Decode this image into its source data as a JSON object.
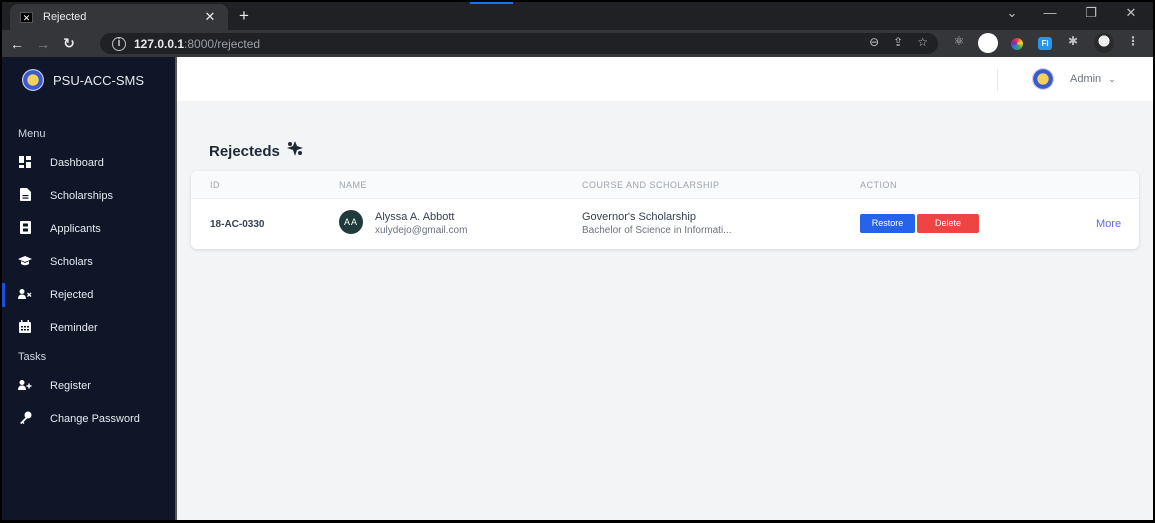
{
  "browser": {
    "tab_title": "Rejected",
    "tab_favicon": "x-icon",
    "url_host": "127.0.0.1",
    "url_path": ":8000/rejected",
    "toolbar_icons": [
      "zoom-out-icon",
      "share-icon",
      "bookmark-star-icon"
    ],
    "extensions": [
      "react-devtools-icon",
      "white-circle-extension-icon",
      "color-picker-extension-icon",
      "fi-extension-icon",
      "puzzle-extensions-icon",
      "profile-avatar-icon",
      "kebab-menu-icon"
    ]
  },
  "sidebar": {
    "brand": "PSU-ACC-SMS",
    "sections": [
      {
        "title": "Menu",
        "items": [
          {
            "label": "Dashboard",
            "icon": "dashboard-grid-icon",
            "glyph": "▚"
          },
          {
            "label": "Scholarships",
            "icon": "document-icon",
            "glyph": "▤"
          },
          {
            "label": "Applicants",
            "icon": "id-badge-icon",
            "glyph": "▣"
          },
          {
            "label": "Scholars",
            "icon": "graduation-cap-icon",
            "glyph": "🎓"
          },
          {
            "label": "Rejected",
            "icon": "user-x-icon",
            "glyph": "👤",
            "active": true
          },
          {
            "label": "Reminder",
            "icon": "calendar-icon",
            "glyph": "▦"
          }
        ]
      },
      {
        "title": "Tasks",
        "items": [
          {
            "label": "Register",
            "icon": "user-plus-icon",
            "glyph": "👤"
          },
          {
            "label": "Change Password",
            "icon": "key-icon",
            "glyph": "🔑"
          }
        ]
      }
    ]
  },
  "header": {
    "user": "Admin",
    "user_chevron": "⌄"
  },
  "page": {
    "title": "Rejecteds",
    "title_icon": "✦"
  },
  "table": {
    "columns": [
      "ID",
      "NAME",
      "COURSE AND SCHOLARSHIP",
      "ACTION"
    ],
    "rows": [
      {
        "id": "18-AC-0330",
        "initials": "AA",
        "name": "Alyssa A. Abbott",
        "email": "xulydejo@gmail.com",
        "scholarship": "Governor's Scholarship",
        "course": "Bachelor of Science in Informati...",
        "restore_label": "Restore",
        "delete_label": "Delete",
        "more_label": "More"
      }
    ]
  },
  "colors": {
    "sidebar_bg": "#0e1628",
    "accent": "#1d4ed8",
    "restore": "#2563eb",
    "delete": "#ef4444",
    "more_link": "#6366f1"
  }
}
